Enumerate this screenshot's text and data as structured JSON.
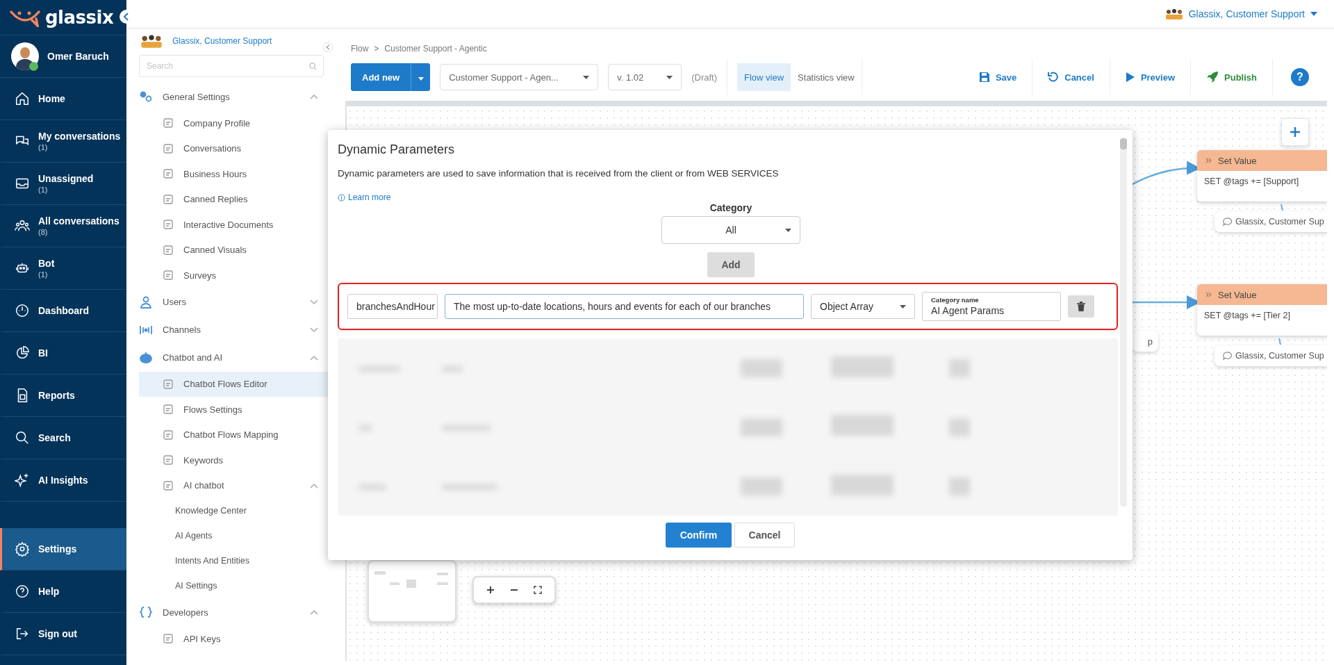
{
  "logo": {
    "text": "glassix"
  },
  "user": {
    "name": "Omer Baruch",
    "online": true
  },
  "nav": [
    {
      "label": "Home",
      "selected": false
    },
    {
      "label": "My conversations",
      "count": "(1)",
      "selected": false
    },
    {
      "label": "Unassigned",
      "count": "(1)",
      "selected": false
    },
    {
      "label": "All conversations",
      "count": "(8)",
      "selected": false
    },
    {
      "label": "Bot",
      "count": "(1)",
      "selected": false
    },
    {
      "label": "Dashboard",
      "selected": false
    },
    {
      "label": "BI",
      "selected": false
    },
    {
      "label": "Reports",
      "selected": false
    },
    {
      "label": "Search",
      "selected": false
    },
    {
      "label": "AI Insights",
      "selected": false
    }
  ],
  "nav_footer": [
    {
      "label": "Settings",
      "selected": true
    },
    {
      "label": "Help",
      "selected": false
    },
    {
      "label": "Sign out",
      "selected": false
    }
  ],
  "account": {
    "name": "Glassix, Customer Support"
  },
  "settings_sidebar": {
    "account": "Glassix, Customer Support",
    "search_placeholder": "Search",
    "sections": [
      {
        "label": "General Settings",
        "expanded": true,
        "children": [
          {
            "label": "Company Profile",
            "selected": false
          },
          {
            "label": "Conversations",
            "selected": false
          },
          {
            "label": "Business Hours",
            "selected": false
          },
          {
            "label": "Canned Replies",
            "selected": false
          },
          {
            "label": "Interactive Documents",
            "selected": false
          },
          {
            "label": "Canned Visuals",
            "selected": false
          },
          {
            "label": "Surveys",
            "selected": false
          }
        ]
      },
      {
        "label": "Users",
        "expanded": false
      },
      {
        "label": "Channels",
        "expanded": false
      },
      {
        "label": "Chatbot and AI",
        "expanded": true,
        "children": [
          {
            "label": "Chatbot Flows Editor",
            "selected": true
          },
          {
            "label": "Flows Settings",
            "selected": false
          },
          {
            "label": "Chatbot Flows Mapping",
            "selected": false
          },
          {
            "label": "Keywords",
            "selected": false
          },
          {
            "label": "AI chatbot",
            "selected": false,
            "expanded": true,
            "children": [
              {
                "label": "Knowledge Center",
                "selected": false
              },
              {
                "label": "AI Agents",
                "selected": false
              },
              {
                "label": "Intents And Entities",
                "selected": false
              },
              {
                "label": "AI Settings",
                "selected": false
              }
            ]
          }
        ]
      },
      {
        "label": "Developers",
        "expanded": true,
        "children": [
          {
            "label": "API Keys",
            "selected": false
          }
        ]
      }
    ]
  },
  "breadcrumb": {
    "items": [
      "Flow",
      "Customer Support - Agentic"
    ],
    "separator": ">"
  },
  "toolbar": {
    "add_new": "Add new",
    "flow": "Customer Support - Agen...",
    "version": "v. 1.02",
    "status": "(Draft)",
    "views": [
      {
        "label": "Flow view",
        "selected": true
      },
      {
        "label": "Statistics view",
        "selected": false
      }
    ],
    "actions": [
      {
        "label": "Save",
        "kind": "save"
      },
      {
        "label": "Cancel",
        "kind": "undo"
      },
      {
        "label": "Preview",
        "kind": "play"
      },
      {
        "label": "Publish",
        "kind": "rocket"
      }
    ],
    "help": "?"
  },
  "canvas": {
    "nodes": [
      {
        "title": "Set Value",
        "body": "SET @tags += [Support]",
        "note": "Glassix, Customer Sup"
      },
      {
        "title": "Set Value",
        "body": "SET @tags += [Tier 2]",
        "note": "Glassix, Customer Sup"
      }
    ],
    "chip": "p"
  },
  "modal": {
    "title": "Dynamic Parameters",
    "description": "Dynamic parameters are used to save information that is received from the client or from WEB SERVICES",
    "learn_more": "Learn more",
    "category_label": "Category",
    "category": "All",
    "add": "Add",
    "parameter": {
      "name": "branchesAndHour",
      "description": "The most up-to-date locations, hours and events for each of our branches",
      "type": "Object Array",
      "category_label": "Category name",
      "category": "AI Agent Params",
      "highlighted": true
    },
    "buttons": [
      {
        "label": "Confirm",
        "kind": "primary"
      },
      {
        "label": "Cancel",
        "kind": "secondary"
      }
    ]
  }
}
